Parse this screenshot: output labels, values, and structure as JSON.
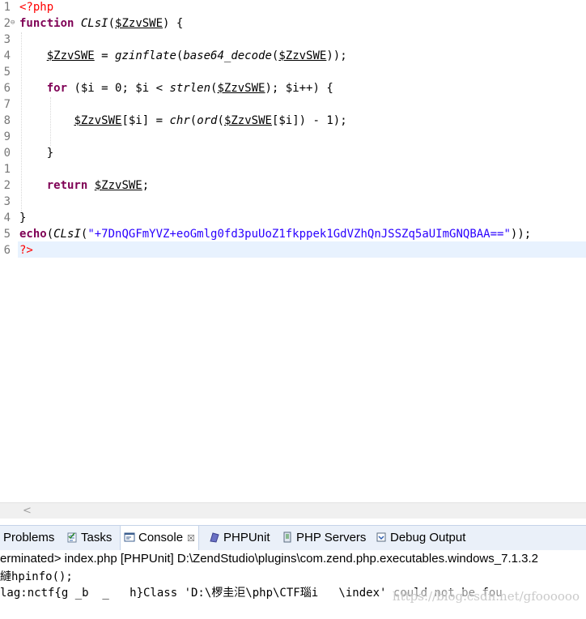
{
  "editor": {
    "line_numbers": [
      "1",
      "2",
      "3",
      "4",
      "5",
      "6",
      "7",
      "8",
      "9",
      "0",
      "1",
      "2",
      "3",
      "4",
      "5",
      "6"
    ],
    "lines": [
      [
        [
          "tag",
          "<?php"
        ]
      ],
      [
        [
          "kw",
          "function"
        ],
        [
          "plain",
          " "
        ],
        [
          "fn",
          "CLsI"
        ],
        [
          "plain",
          "("
        ],
        [
          "var",
          "$ZzvSWE"
        ],
        [
          "plain",
          ") {"
        ]
      ],
      [],
      [
        [
          "plain",
          "    "
        ],
        [
          "var",
          "$ZzvSWE"
        ],
        [
          "plain",
          " = "
        ],
        [
          "fn",
          "gzinflate"
        ],
        [
          "plain",
          "("
        ],
        [
          "fn",
          "base64_decode"
        ],
        [
          "plain",
          "("
        ],
        [
          "var",
          "$ZzvSWE"
        ],
        [
          "plain",
          "));"
        ]
      ],
      [],
      [
        [
          "plain",
          "    "
        ],
        [
          "kw",
          "for"
        ],
        [
          "plain",
          " ($i = 0; $i < "
        ],
        [
          "fn",
          "strlen"
        ],
        [
          "plain",
          "("
        ],
        [
          "var",
          "$ZzvSWE"
        ],
        [
          "plain",
          "); $i++) {"
        ]
      ],
      [],
      [
        [
          "plain",
          "        "
        ],
        [
          "var",
          "$ZzvSWE"
        ],
        [
          "plain",
          "[$i] = "
        ],
        [
          "fn",
          "chr"
        ],
        [
          "plain",
          "("
        ],
        [
          "fn",
          "ord"
        ],
        [
          "plain",
          "("
        ],
        [
          "var",
          "$ZzvSWE"
        ],
        [
          "plain",
          "[$i]) - 1);"
        ]
      ],
      [],
      [
        [
          "plain",
          "    }"
        ]
      ],
      [],
      [
        [
          "plain",
          "    "
        ],
        [
          "kw",
          "return"
        ],
        [
          "plain",
          " "
        ],
        [
          "var",
          "$ZzvSWE"
        ],
        [
          "plain",
          ";"
        ]
      ],
      [],
      [
        [
          "plain",
          "}"
        ]
      ],
      [
        [
          "kw",
          "echo"
        ],
        [
          "plain",
          "("
        ],
        [
          "fn",
          "CLsI"
        ],
        [
          "plain",
          "("
        ],
        [
          "str",
          "\"+7DnQGFmYVZ+eoGmlg0fd3puUoZ1fkppek1GdVZhQnJSSZq5aUImGNQBAA==\""
        ],
        [
          "plain",
          "));"
        ]
      ],
      [
        [
          "tag",
          "?>"
        ]
      ]
    ]
  },
  "tabs": [
    {
      "label": "Problems",
      "icon": "problems-icon",
      "active": false
    },
    {
      "label": "Tasks",
      "icon": "tasks-icon",
      "active": false
    },
    {
      "label": "Console",
      "icon": "console-icon",
      "active": true,
      "close": "☒"
    },
    {
      "label": "PHPUnit",
      "icon": "phpunit-icon",
      "active": false
    },
    {
      "label": "PHP Servers",
      "icon": "php-servers-icon",
      "active": false
    },
    {
      "label": "Debug Output",
      "icon": "debug-output-icon",
      "active": false
    }
  ],
  "console": {
    "status": "erminated> index.php [PHPUnit] D:\\ZendStudio\\plugins\\com.zend.php.executables.windows_7.1.3.2",
    "output_line1": "縺hpinfo();",
    "output_line2": "lag:nctf{g _b  _   h}Class 'D:\\椤圭洰\\php\\CTF瑙i   \\index' could not be fou",
    "watermark": "https://blog.csdn.net/gfoooooo"
  },
  "colors": {
    "keyword": "#7f0055",
    "php_tag": "#ff0000",
    "string": "#2a00ff",
    "line_number": "#787878",
    "current_line": "#e8f2fe",
    "tab_bar": "#eaf0f9"
  }
}
